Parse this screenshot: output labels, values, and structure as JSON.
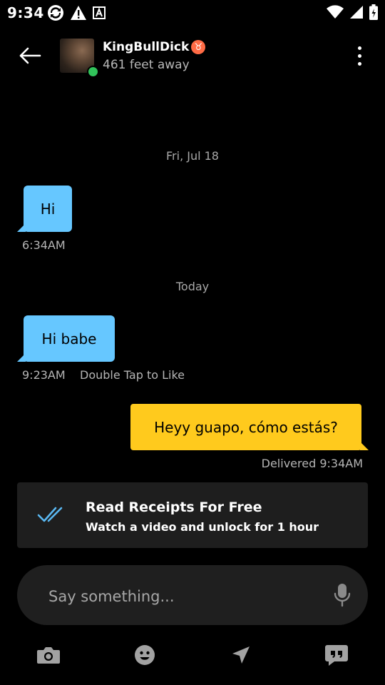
{
  "status_bar": {
    "time": "9:34",
    "left_icons": [
      "sync-icon",
      "warning-icon",
      "font-a-icon"
    ],
    "right_icons": [
      "wifi-icon",
      "signal-icon",
      "battery-icon"
    ]
  },
  "header": {
    "username": "KingBullDick",
    "zodiac": "♉",
    "distance": "461 feet away",
    "online": true
  },
  "conversation": {
    "date_sep_1": "Fri, Jul 18",
    "msg1": {
      "text": "Hi",
      "time": "6:34AM"
    },
    "date_sep_2": "Today",
    "msg2": {
      "text": "Hi babe",
      "time": "9:23AM",
      "hint": "Double Tap to Like"
    },
    "msg3": {
      "text": "Heyy guapo, cómo estás?",
      "status": "Delivered 9:34AM"
    }
  },
  "promo": {
    "title": "Read Receipts For Free",
    "subtitle": "Watch a video and unlock for 1 hour"
  },
  "composer": {
    "placeholder": "Say something..."
  },
  "toolbar": [
    "camera-icon",
    "emoji-icon",
    "location-icon",
    "saved-phrases-icon"
  ],
  "colors": {
    "incoming_bubble": "#66c7ff",
    "outgoing_bubble": "#ffca1d",
    "online": "#31c35a",
    "background": "#000000"
  }
}
